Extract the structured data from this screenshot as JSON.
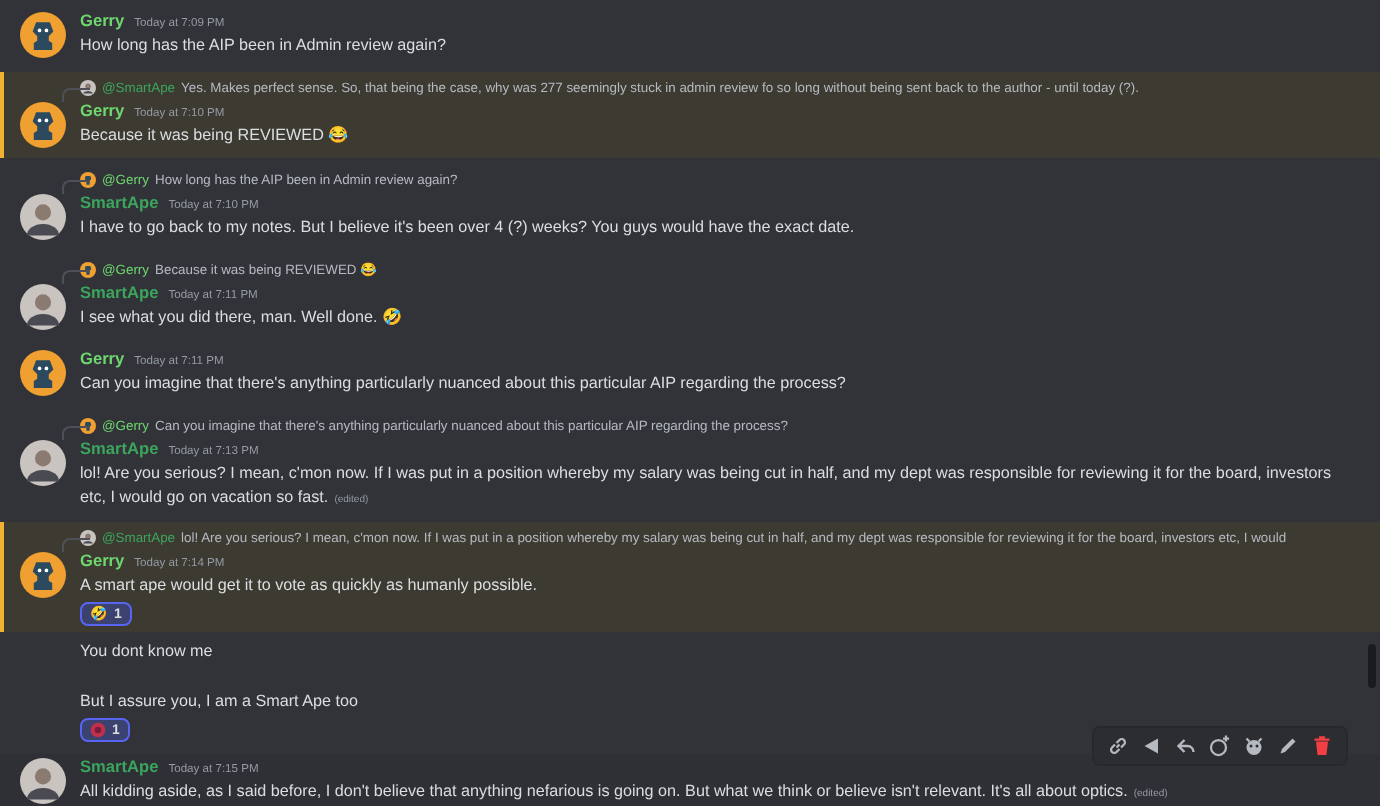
{
  "messages": [
    {
      "kind": "message",
      "author": "Gerry",
      "color": "#6ed66e",
      "avatar": {
        "kind": "ape"
      },
      "time": "Today at 7:09 PM",
      "highlighted": false,
      "paragraphs": [
        "How long has the AIP been in Admin review again?"
      ]
    },
    {
      "kind": "message",
      "author": "Gerry",
      "color": "#6ed66e",
      "avatar": {
        "kind": "ape"
      },
      "time": "Today at 7:10 PM",
      "highlighted": true,
      "reply": {
        "avatar": {
          "kind": "person"
        },
        "author": "@SmartApe",
        "color": "#3ba55d",
        "text": "Yes. Makes perfect sense. So, that being the case, why was 277 seemingly stuck in admin review fo so long without being sent back to the author - until today (?)."
      },
      "paragraphs": [
        "Because it was being REVIEWED 😂"
      ]
    },
    {
      "kind": "message",
      "author": "SmartApe",
      "color": "#3ba55d",
      "avatar": {
        "kind": "person"
      },
      "time": "Today at 7:10 PM",
      "highlighted": false,
      "reply": {
        "avatar": {
          "kind": "ape"
        },
        "author": "@Gerry",
        "color": "#6ed66e",
        "text": "How long has the AIP been in Admin review again?"
      },
      "paragraphs": [
        "I have to go back to my notes. But I believe it's been over 4 (?) weeks? You guys would have the exact date."
      ]
    },
    {
      "kind": "message",
      "author": "SmartApe",
      "color": "#3ba55d",
      "avatar": {
        "kind": "person"
      },
      "time": "Today at 7:11 PM",
      "highlighted": false,
      "reply": {
        "avatar": {
          "kind": "ape"
        },
        "author": "@Gerry",
        "color": "#6ed66e",
        "text": "Because it was being REVIEWED 😂"
      },
      "paragraphs": [
        "I see what you did there, man. Well done. 🤣"
      ]
    },
    {
      "kind": "message",
      "author": "Gerry",
      "color": "#6ed66e",
      "avatar": {
        "kind": "ape"
      },
      "time": "Today at 7:11 PM",
      "highlighted": false,
      "paragraphs": [
        "Can you imagine that there's anything particularly nuanced about this particular AIP regarding the process?"
      ]
    },
    {
      "kind": "message",
      "author": "SmartApe",
      "color": "#3ba55d",
      "avatar": {
        "kind": "person"
      },
      "time": "Today at 7:13 PM",
      "highlighted": false,
      "reply": {
        "avatar": {
          "kind": "ape"
        },
        "author": "@Gerry",
        "color": "#6ed66e",
        "text": "Can you imagine that there's anything particularly nuanced about this particular AIP regarding the process?"
      },
      "paragraphs": [
        "lol! Are you serious? I mean, c'mon now. If I was put in a position whereby my salary was being cut in half, and my dept was responsible for reviewing it for the board, investors etc, I would go on vacation so fast."
      ],
      "edited": "(edited)"
    },
    {
      "kind": "message",
      "author": "Gerry",
      "color": "#6ed66e",
      "avatar": {
        "kind": "ape"
      },
      "time": "Today at 7:14 PM",
      "highlighted": true,
      "reply": {
        "avatar": {
          "kind": "person"
        },
        "author": "@SmartApe",
        "color": "#3ba55d",
        "text": "lol! Are you serious? I mean, c'mon now. If I was put in a position whereby my salary was being cut in half, and my dept was responsible for reviewing it for the board, investors etc, I would"
      },
      "paragraphs": [
        "A smart ape would get it to vote as quickly as humanly possible."
      ],
      "reactions": [
        {
          "kind": "emoji",
          "emoji": "🤣",
          "count": "1",
          "reacted": true
        }
      ]
    },
    {
      "kind": "continuation",
      "highlighted": false,
      "paragraphs": [
        "You dont know me",
        "But I assure you, I am a Smart Ape too"
      ],
      "reactions": [
        {
          "kind": "sticker",
          "count": "1",
          "reacted": true
        }
      ]
    },
    {
      "kind": "message",
      "author": "SmartApe",
      "color": "#3ba55d",
      "avatar": {
        "kind": "person"
      },
      "time": "Today at 7:15 PM",
      "highlighted": false,
      "hovered": true,
      "paragraphs": [
        "All kidding aside, as I said before, I don't believe that anything nefarious is going on. But what we think or believe isn't relevant. It's all about optics."
      ],
      "edited": "(edited)"
    }
  ]
}
